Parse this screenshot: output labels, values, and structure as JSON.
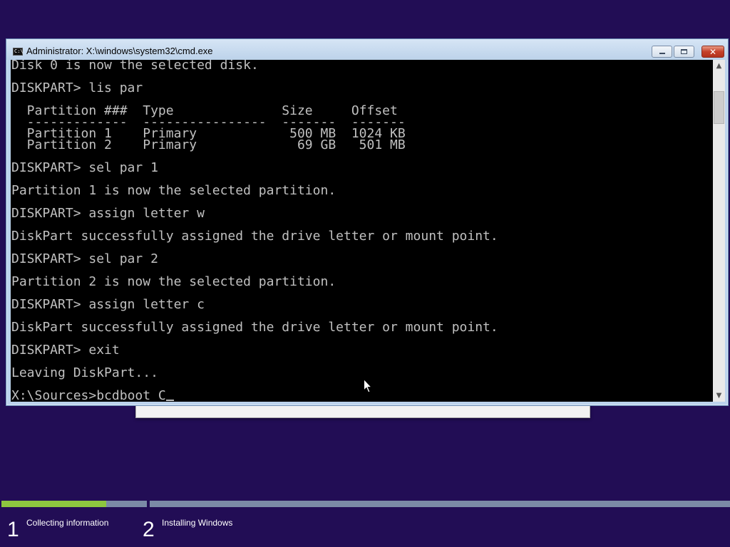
{
  "window": {
    "title": "Administrator: X:\\windows\\system32\\cmd.exe",
    "icon": "cmd-icon",
    "minimize_symbol": "minimize-icon",
    "maximize_symbol": "maximize-icon",
    "close_glyph": "✕"
  },
  "console": {
    "lines": [
      "Disk 0 is now the selected disk.",
      "",
      "DISKPART> lis par",
      "",
      "  Partition ###  Type              Size     Offset",
      "  -------------  ----------------  -------  -------",
      "  Partition 1    Primary            500 MB  1024 KB",
      "  Partition 2    Primary             69 GB   501 MB",
      "",
      "DISKPART> sel par 1",
      "",
      "Partition 1 is now the selected partition.",
      "",
      "DISKPART> assign letter w",
      "",
      "DiskPart successfully assigned the drive letter or mount point.",
      "",
      "DISKPART> sel par 2",
      "",
      "Partition 2 is now the selected partition.",
      "",
      "DISKPART> assign letter c",
      "",
      "DiskPart successfully assigned the drive letter or mount point.",
      "",
      "DISKPART> exit",
      "",
      "Leaving DiskPart...",
      ""
    ],
    "prompt": "X:\\Sources>",
    "input": "bcdboot C"
  },
  "setup": {
    "steps": [
      {
        "number": "1",
        "label": "Collecting information",
        "progress": 0.72
      },
      {
        "number": "2",
        "label": "Installing Windows",
        "progress": 0
      }
    ]
  },
  "colors": {
    "background": "#220d55",
    "progress_fill": "#8dc63f",
    "progress_track": "#7b8aa6"
  }
}
